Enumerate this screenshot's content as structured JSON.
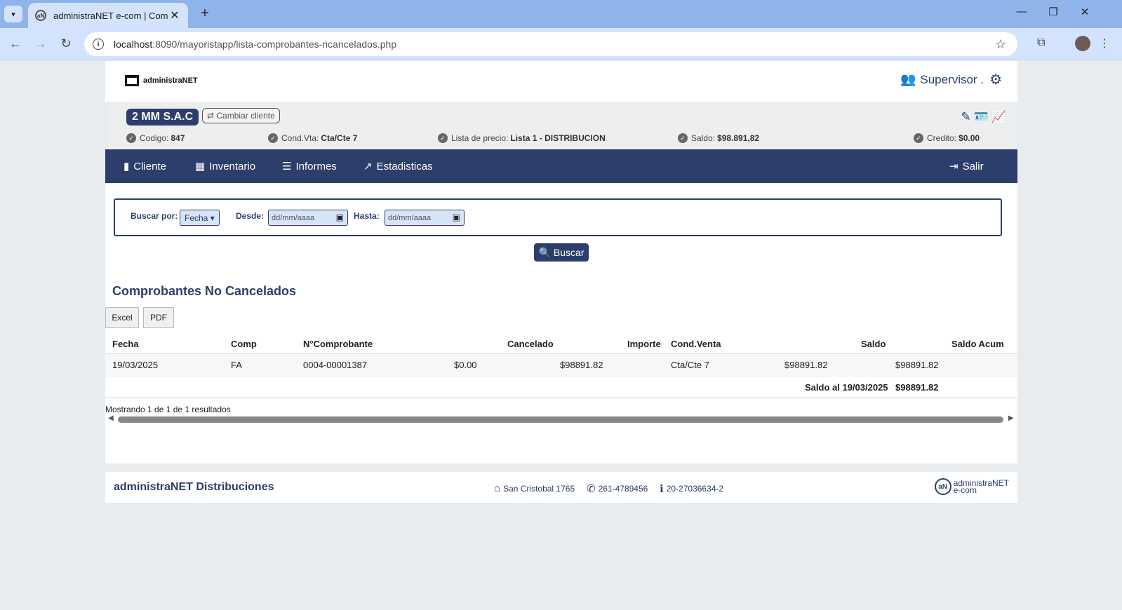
{
  "browser": {
    "tab_title": "administraNET e-com | Compro",
    "url_host": "localhost",
    "url_rest": ":8090/mayoristapp/lista-comprobantes-ncancelados.php"
  },
  "header": {
    "logo_text": "administraNET",
    "user_name": "Supervisor ."
  },
  "client": {
    "name": "2 MM S.A.C",
    "change_label": "Cambiar cliente",
    "info": {
      "codigo_label": "Codigo:",
      "codigo_value": "847",
      "condvta_label": "Cond.Vta:",
      "condvta_value": "Cta/Cte 7",
      "lista_label": "Lista de precio:",
      "lista_value": "Lista 1 - DISTRIBUCION",
      "saldo_label": "Saldo:",
      "saldo_value": "$98.891,82",
      "credito_label": "Credito:",
      "credito_value": "$0.00"
    }
  },
  "nav": {
    "cliente": "Cliente",
    "inventario": "Inventario",
    "informes": "Informes",
    "estadisticas": "Estadisticas",
    "salir": "Salir"
  },
  "search": {
    "buscar_por_label": "Buscar por:",
    "buscar_por_value": "Fecha",
    "desde_label": "Desde:",
    "desde_placeholder": "dd/mm/aaaa",
    "hasta_label": "Hasta:",
    "hasta_placeholder": "dd/mm/aaaa",
    "buscar_button": "Buscar"
  },
  "results": {
    "title": "Comprobantes No Cancelados",
    "excel": "Excel",
    "pdf": "PDF",
    "columns": {
      "fecha": "Fecha",
      "comp": "Comp",
      "numero": "N°Comprobante",
      "cancelado": "Cancelado",
      "importe": "Importe",
      "condventa": "Cond.Venta",
      "saldo": "Saldo",
      "saldo_acum": "Saldo Acum"
    },
    "rows": [
      {
        "fecha": "19/03/2025",
        "comp": "FA",
        "numero": "0004-00001387",
        "cancelado": "$0.00",
        "importe": "$98891.82",
        "condventa": "Cta/Cte 7",
        "saldo": "$98891.82",
        "saldo_acum": "$98891.82"
      }
    ],
    "footer_label": "Saldo al 19/03/2025",
    "footer_value": "$98891.82",
    "showing": "Mostrando 1 de 1 de 1 resultados"
  },
  "footer": {
    "brand": "administraNET Distribuciones",
    "address": "San Cristobal 1765",
    "phone": "261-4789456",
    "cuit": "20-27036634-2",
    "logo_text": "administraNET",
    "logo_sub": "e-com"
  }
}
